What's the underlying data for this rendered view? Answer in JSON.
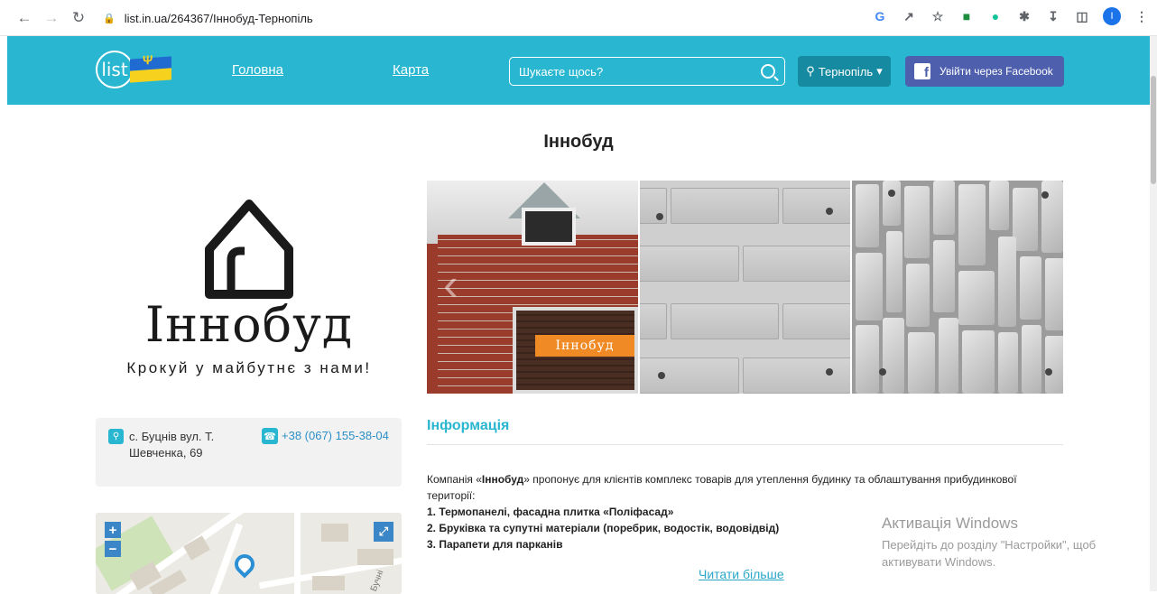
{
  "browser": {
    "url": "list.in.ua/264367/Іннобуд-Тернопіль",
    "icons": [
      "back-icon",
      "forward-icon",
      "reload-icon",
      "lock-icon",
      "google-icon",
      "share-icon",
      "star-icon",
      "extension-green-icon",
      "grammarly-icon",
      "puzzle-icon",
      "download-icon",
      "sidepanel-icon",
      "profile-avatar",
      "menu-icon"
    ],
    "avatar_letter": "I"
  },
  "header": {
    "logo_text": "list",
    "nav": [
      {
        "label": "Головна"
      },
      {
        "label": "Карта"
      }
    ],
    "search_placeholder": "Шукаєте щось?",
    "city_label": "Тернопіль",
    "facebook_label": "Увійти через Facebook",
    "colors": {
      "primary": "#29b6d0",
      "city_btn": "#168aa0",
      "facebook": "#4d5fad"
    }
  },
  "page": {
    "title": "Іннобуд"
  },
  "company_logo": {
    "name": "Іннобуд",
    "slogan": "Крокуй у майбутнє з нами!"
  },
  "gallery": {
    "badge": "Іннобуд"
  },
  "contact": {
    "address": "с. Буцнів вул. Т. Шевченка, 69",
    "phone": "+38 (067) 155-38-04"
  },
  "map": {
    "zoom_in": "+",
    "zoom_out": "−",
    "street_label": "Бучні"
  },
  "info": {
    "title": "Інформація",
    "intro_prefix": "Компанія «",
    "intro_brand": "Іннобуд",
    "intro_suffix": "» пропонує для клієнтів комплекс товарів для утеплення будинку та облаштування прибудинкової території:",
    "items": [
      "1. Термопанелі, фасадна плитка «Поліфасад»",
      "2. Бруківка та супутні матеріали (поребрик, водостік, водовідвід)",
      "3. Парапети для парканів"
    ],
    "read_more": "Читати більше"
  },
  "windows_watermark": {
    "title": "Активація Windows",
    "subtitle": "Перейдіть до розділу \"Настройки\", щоб активувати Windows."
  }
}
